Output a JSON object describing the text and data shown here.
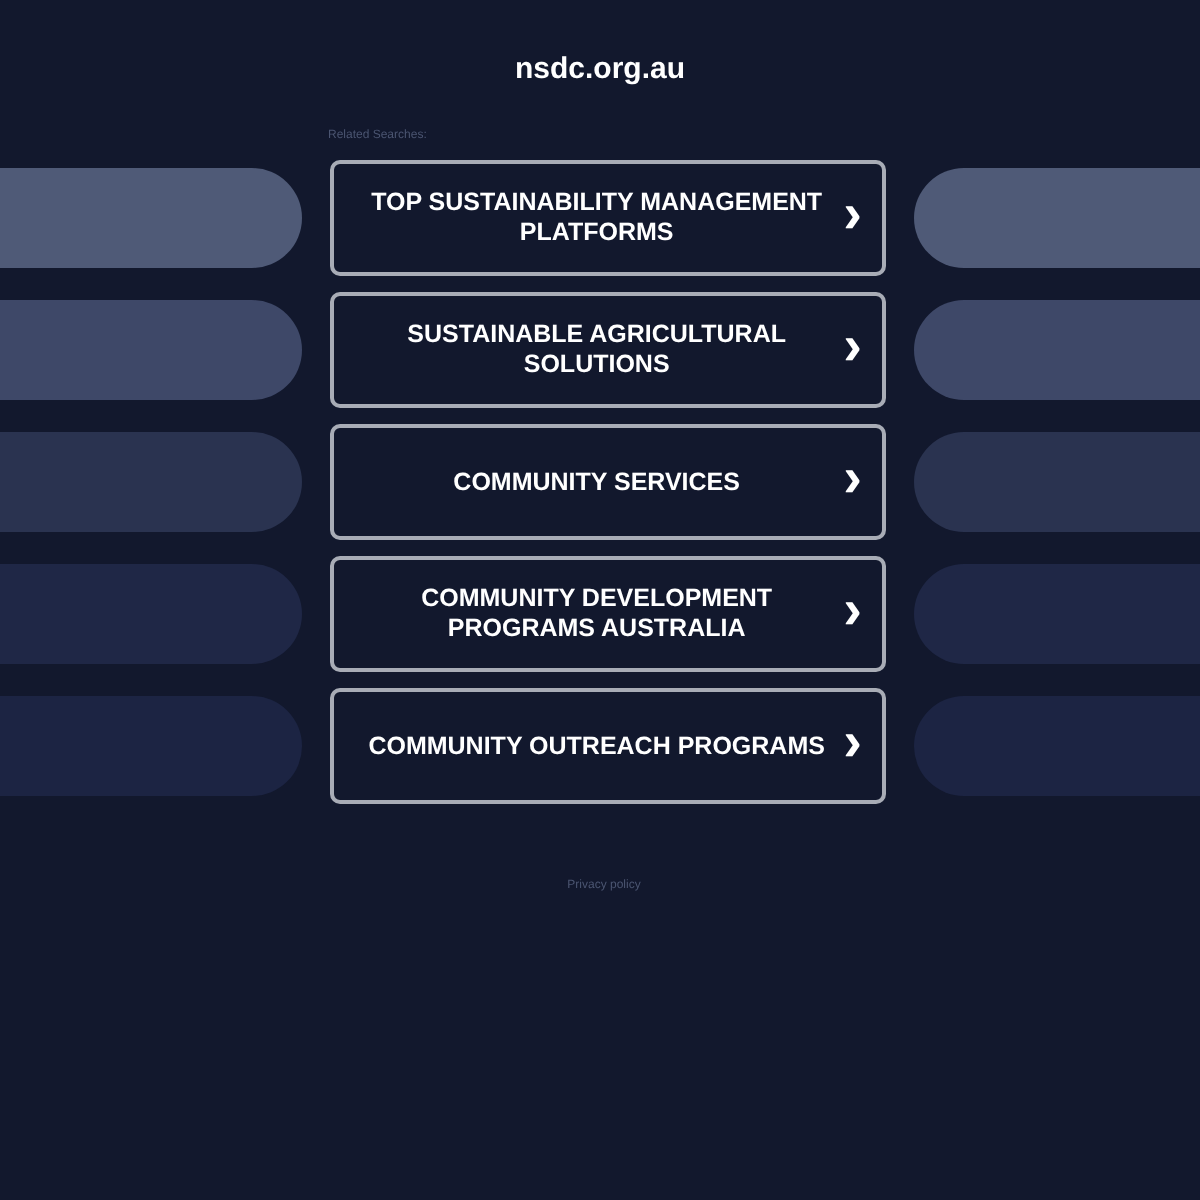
{
  "site_title": "nsdc.org.au",
  "related_label": "Related Searches:",
  "links": [
    {
      "label": "TOP SUSTAINABILITY MANAGEMENT PLATFORMS",
      "icon": "›"
    },
    {
      "label": "SUSTAINABLE AGRICULTURAL SOLUTIONS",
      "icon": "›"
    },
    {
      "label": "COMMUNITY SERVICES",
      "icon": "›"
    },
    {
      "label": "COMMUNITY DEVELOPMENT PROGRAMS AUSTRALIA",
      "icon": "›"
    },
    {
      "label": "COMMUNITY OUTREACH PROGRAMS",
      "icon": "›"
    }
  ],
  "footer_link": "Privacy policy"
}
